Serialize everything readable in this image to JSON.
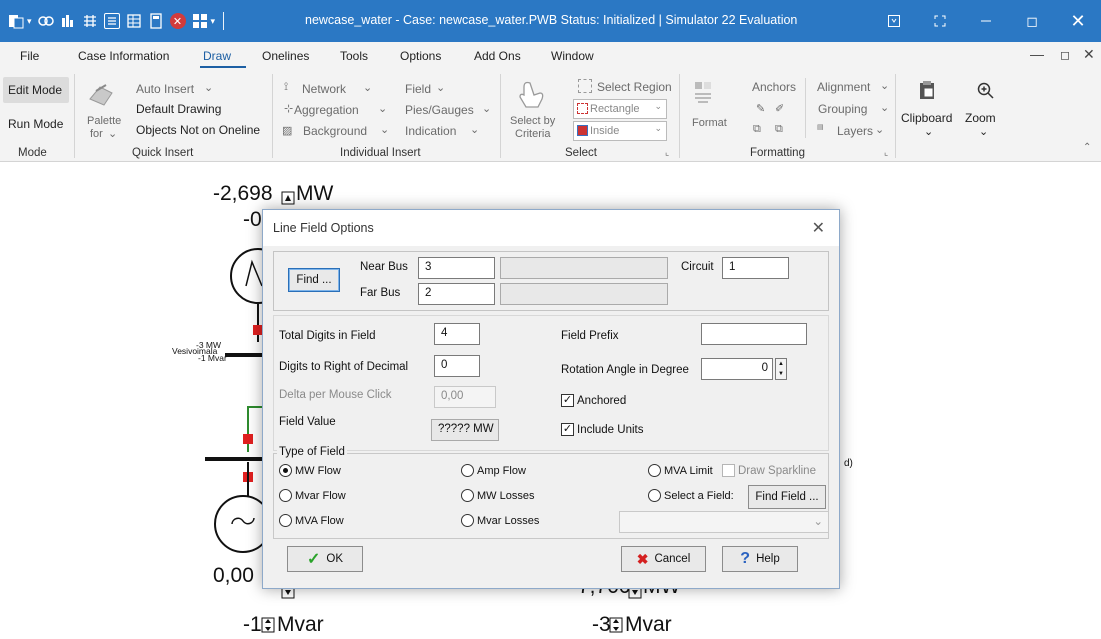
{
  "titlebar": {
    "title": "newcase_water - Case: newcase_water.PWB  Status: Initialized | Simulator 22 Evaluation",
    "restore_glyph": "◻",
    "close_glyph": "✕"
  },
  "menu": {
    "tabs": [
      "File",
      "Case Information",
      "Draw",
      "Onelines",
      "Tools",
      "Options",
      "Add Ons",
      "Window"
    ],
    "active": "Draw"
  },
  "ribbon": {
    "mode": {
      "edit": "Edit Mode",
      "run": "Run Mode",
      "group": "Mode"
    },
    "quick_insert": {
      "palette_line1": "Palette",
      "palette_line2": "for",
      "auto_insert": "Auto Insert",
      "default_drawing": "Default Drawing",
      "objects_not_on_oneline": "Objects Not on Oneline",
      "group": "Quick Insert"
    },
    "individual_insert": {
      "network": "Network",
      "aggregation": "Aggregation",
      "background": "Background",
      "field": "Field",
      "pies_gauges": "Pies/Gauges",
      "indication": "Indication",
      "group": "Individual Insert"
    },
    "select": {
      "select_by_line1": "Select by",
      "select_by_line2": "Criteria",
      "select_region": "Select Region",
      "rectangle": "Rectangle",
      "inside": "Inside",
      "group": "Select"
    },
    "formatting": {
      "format": "Format",
      "anchors": "Anchors",
      "alignment": "Alignment",
      "grouping": "Grouping",
      "layers": "Layers",
      "group": "Formatting"
    },
    "clipboard": "Clipboard",
    "zoom": "Zoom"
  },
  "canvas": {
    "top_flow": "-2,698",
    "top_unit": "MW",
    "top_mvar_partial": "-0",
    "vesi_label": "Vesivoimala",
    "vesi_mw": "-3 MW",
    "vesi_mvar": "-1 Mvar",
    "bottom_left_value": "0,00",
    "bottom_left_mvar": "-1",
    "bottom_right_mw": "7,700",
    "bottom_right_mvar": "-3",
    "mw_unit": "MW",
    "mvar_unit": "Mvar",
    "right_edge_text": "d)"
  },
  "dialog": {
    "title": "Line Field Options",
    "find_button": "Find ...",
    "near_bus_label": "Near Bus",
    "near_bus_value": "3",
    "far_bus_label": "Far Bus",
    "far_bus_value": "2",
    "circuit_label": "Circuit",
    "circuit_value": "1",
    "total_digits_label": "Total Digits in Field",
    "total_digits_value": "4",
    "digits_right_label": "Digits to Right of Decimal",
    "digits_right_value": "0",
    "delta_label": "Delta per Mouse Click",
    "delta_value": "0,00",
    "field_value_label": "Field Value",
    "field_value_value": "????? MW",
    "field_prefix_label": "Field Prefix",
    "field_prefix_value": "",
    "rotation_label": "Rotation Angle in Degree",
    "rotation_value": "0",
    "anchored_label": "Anchored",
    "anchored_checked": true,
    "include_units_label": "Include Units",
    "include_units_checked": true,
    "type_of_field_label": "Type of Field",
    "radios": {
      "mw_flow": "MW Flow",
      "mvar_flow": "Mvar Flow",
      "mva_flow": "MVA Flow",
      "amp_flow": "Amp Flow",
      "mw_losses": "MW Losses",
      "mvar_losses": "Mvar Losses",
      "mva_limit": "MVA Limit",
      "select_a_field": "Select a Field:"
    },
    "selected_radio": "MW Flow",
    "draw_sparkline_label": "Draw Sparkline",
    "find_field_button": "Find Field ...",
    "ok_button": "OK",
    "cancel_button": "Cancel",
    "help_button": "Help"
  },
  "colors": {
    "titlebar": "#2b78c4",
    "ribbon_bg": "#f3f3f3",
    "active_tab": "#1d5fa3",
    "breaker_red": "#e02020",
    "branch_green": "#2e8b2e",
    "ok_check": "#2aa32a",
    "cancel_x": "#d42020",
    "help_q": "#2a62c0"
  }
}
